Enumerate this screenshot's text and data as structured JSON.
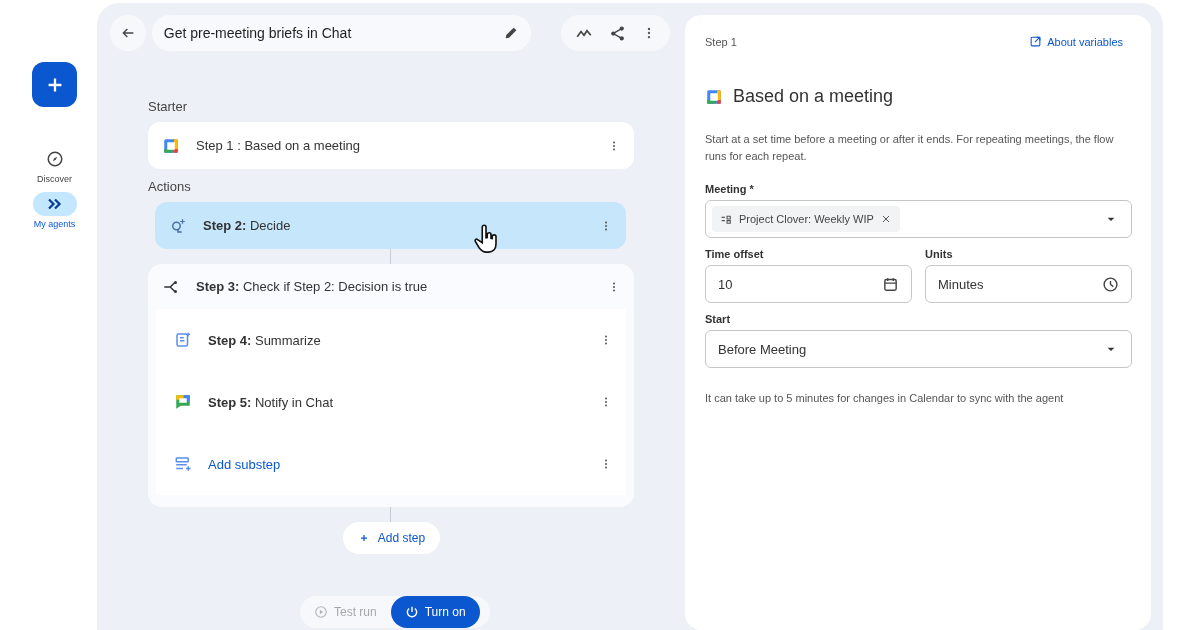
{
  "rail": {
    "create_button": {
      "kind": "plus"
    },
    "nav": [
      {
        "label": "Discover",
        "selected": false
      },
      {
        "label": "My agents",
        "selected": true
      }
    ]
  },
  "flow": {
    "title": "Get pre-meeting briefs in Chat",
    "starter": {
      "label": "Starter",
      "step": {
        "kind": "calendar",
        "title": "Step 1 : Based on a meeting",
        "selected": false
      }
    },
    "actions": {
      "label": "Actions",
      "items": [
        {
          "kind": "decide",
          "title": "**Step 2:** Decide",
          "selected": true
        },
        {
          "kind": "condition",
          "title": "**Step 3:** Check if Step 2: Decision is true",
          "selected": false,
          "children": [
            {
              "kind": "summarize",
              "title": "**Step 4:** Summarize",
              "selected": false
            },
            {
              "kind": "chat",
              "title": "**Step 5:** Notify in Chat",
              "selected": false
            },
            {
              "kind": "add_substep",
              "title": "Add substep",
              "selected": false
            }
          ]
        }
      ]
    },
    "add_step": "Add step",
    "bottom_buttons": [
      {
        "kind": "test",
        "label": "Test run",
        "disabled": true
      },
      {
        "kind": "turn_on",
        "label": "Turn on",
        "disabled": false
      }
    ]
  },
  "panel": {
    "step_label": "Step 1",
    "about_link": "About variables",
    "heading": "Based on a meeting",
    "description": "Start at a set time before a meeting or after it ends. For repeating meetings, the flow runs for each repeat.",
    "meeting": {
      "label": "Meeting *",
      "chip": "Project Clover: Weekly WIP"
    },
    "time_offset": {
      "label": "Time offset",
      "value": "10"
    },
    "units": {
      "label": "Units",
      "value": "Minutes"
    },
    "start": {
      "label": "Start",
      "value": "Before Meeting"
    },
    "note": "It can take up to 5 minutes for changes in Calendar to sync with the agent"
  }
}
